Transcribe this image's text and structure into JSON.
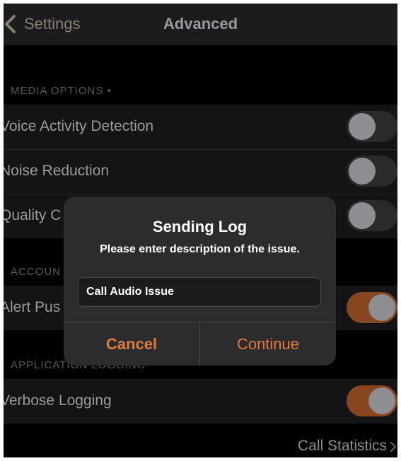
{
  "navbar": {
    "back_label": "Settings",
    "title": "Advanced"
  },
  "sections": {
    "media_options": {
      "header": "MEDIA OPTIONS •",
      "rows": [
        {
          "label": "Voice Activity Detection",
          "on": false
        },
        {
          "label": "Noise Reduction",
          "on": false
        },
        {
          "label": "Quality C",
          "on": false
        }
      ]
    },
    "accounts": {
      "header": "ACCOUN",
      "rows": [
        {
          "label": "Alert Pus",
          "on": true
        }
      ]
    },
    "application_logging": {
      "header": "APPLICATION LOGGING",
      "rows": [
        {
          "label": "Verbose Logging",
          "on": true
        }
      ]
    }
  },
  "footer": {
    "call_statistics_label": "Call Statistics"
  },
  "dialog": {
    "title": "Sending Log",
    "message": "Please enter description of the issue.",
    "input_value": "Call Audio Issue",
    "cancel_label": "Cancel",
    "continue_label": "Continue"
  },
  "colors": {
    "accent": "#e07a3a",
    "toggle_on": "#874620",
    "background": "#000000"
  },
  "icons": {
    "back": "chevron-left-icon",
    "footer": "chevron-right-icon"
  }
}
